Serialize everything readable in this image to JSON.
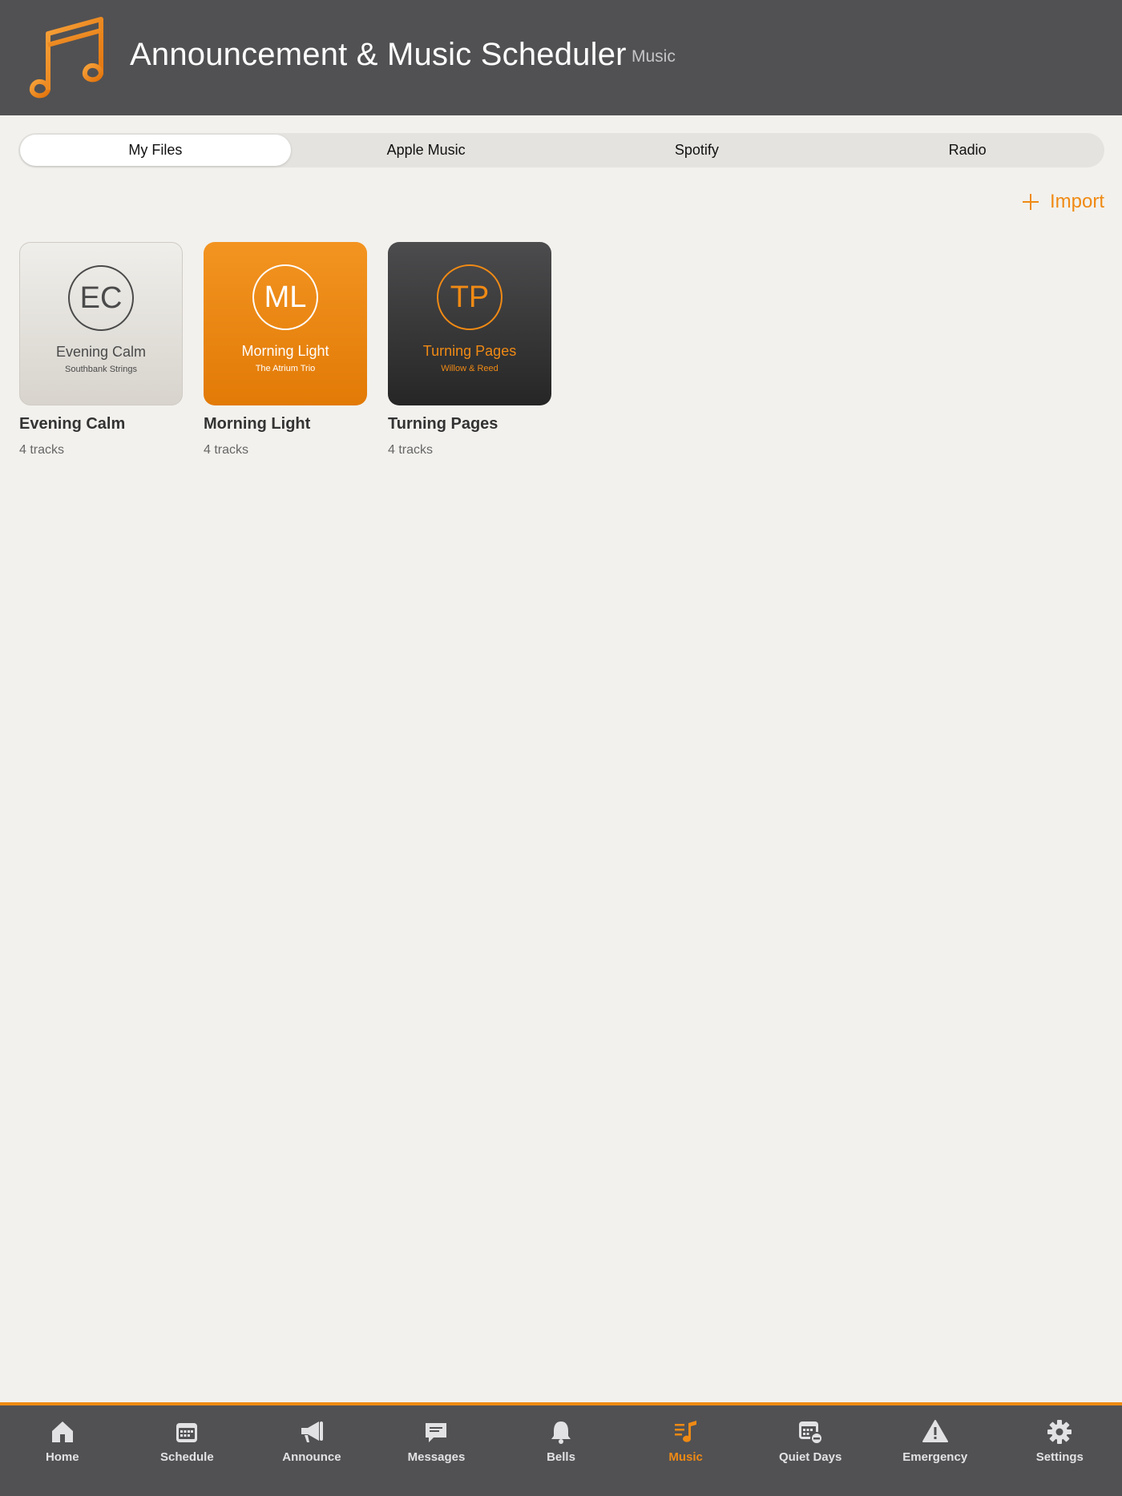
{
  "header": {
    "title": "Announcement & Music Scheduler",
    "section": "Music",
    "logo_icon": "music-note-icon",
    "accent_color": "#f08a14"
  },
  "sources": {
    "tabs": [
      {
        "label": "My Files",
        "active": true
      },
      {
        "label": "Apple Music",
        "active": false
      },
      {
        "label": "Spotify",
        "active": false
      },
      {
        "label": "Radio",
        "active": false
      }
    ]
  },
  "import_label": "Import",
  "albums": [
    {
      "initials": "EC",
      "art_title": "Evening Calm",
      "art_artist": "Southbank Strings",
      "name": "Evening Calm",
      "tracks": "4 tracks"
    },
    {
      "initials": "ML",
      "art_title": "Morning Light",
      "art_artist": "The Atrium Trio",
      "name": "Morning Light",
      "tracks": "4 tracks"
    },
    {
      "initials": "TP",
      "art_title": "Turning Pages",
      "art_artist": "Willow & Reed",
      "name": "Turning Pages",
      "tracks": "4 tracks"
    }
  ],
  "tabbar": {
    "items": [
      {
        "label": "Home",
        "icon": "home-icon"
      },
      {
        "label": "Schedule",
        "icon": "calendar-icon"
      },
      {
        "label": "Announce",
        "icon": "megaphone-icon"
      },
      {
        "label": "Messages",
        "icon": "message-bubble-icon"
      },
      {
        "label": "Bells",
        "icon": "bell-icon"
      },
      {
        "label": "Music",
        "icon": "music-list-icon",
        "active": true
      },
      {
        "label": "Quiet Days",
        "icon": "calendar-minus-icon"
      },
      {
        "label": "Emergency",
        "icon": "warning-icon"
      },
      {
        "label": "Settings",
        "icon": "gear-icon"
      }
    ]
  }
}
